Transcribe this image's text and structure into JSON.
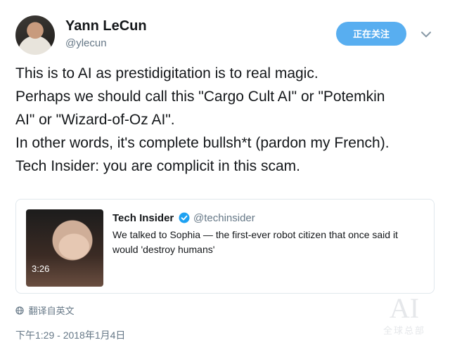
{
  "author": {
    "name": "Yann LeCun",
    "handle": "@ylecun",
    "follow_label": "正在关注"
  },
  "tweet": {
    "lines": [
      "This is to AI as prestidigitation is to real magic.",
      "Perhaps we should call this \"Cargo Cult AI\" or \"Potemkin",
      "AI\" or \"Wizard-of-Oz AI\".",
      "In other words, it's complete bullsh*t (pardon my French).",
      "Tech Insider: you are complicit in this scam."
    ]
  },
  "quoted": {
    "name": "Tech Insider",
    "handle": "@techinsider",
    "text": "We talked to Sophia — the first-ever robot citizen that once said it would 'destroy humans'",
    "duration": "3:26"
  },
  "translate_label": "翻译自英文",
  "timestamp": "下午1:29 - 2018年1月4日",
  "watermark": {
    "big": "AI",
    "small": "全球总部"
  },
  "colors": {
    "accent": "#58aef0",
    "verified": "#1da1f2",
    "muted": "#657786"
  },
  "icons": [
    "chevron-down-icon",
    "verified-badge-icon",
    "globe-icon"
  ]
}
